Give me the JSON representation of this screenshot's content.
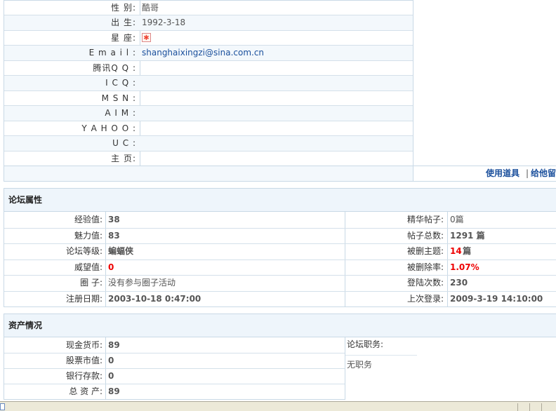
{
  "profile": [
    {
      "label": "性 别:",
      "value": "酷哥"
    },
    {
      "label": "出 生:",
      "value": "1992-3-18"
    },
    {
      "label": "星 座:",
      "value": ""
    },
    {
      "label": "E m a i l :",
      "value": "shanghaixingzi@sina.com.cn"
    },
    {
      "label": "腾讯Q Q :",
      "value": ""
    },
    {
      "label": "I C Q :",
      "value": ""
    },
    {
      "label": "M S N :",
      "value": ""
    },
    {
      "label": "A I M :",
      "value": ""
    },
    {
      "label": "Y A H O O :",
      "value": ""
    },
    {
      "label": "U C :",
      "value": ""
    },
    {
      "label": "主 页:",
      "value": ""
    }
  ],
  "actions": {
    "use_tools": "使用道具",
    "leave_msg": "给他留"
  },
  "forum": {
    "title": "论坛属性",
    "left": [
      {
        "label": "经验值:",
        "value": "38"
      },
      {
        "label": "魅力值:",
        "value": "83"
      },
      {
        "label": "论坛等级:",
        "value": "蝙蝠侠"
      },
      {
        "label": "威望值:",
        "value": "0"
      },
      {
        "label": "圈 子:",
        "value": "没有参与圈子活动"
      },
      {
        "label": "注册日期:",
        "value": "2003-10-18 0:47:00"
      }
    ],
    "right": [
      {
        "label": "精华帖子:",
        "value": "0篇"
      },
      {
        "label": "帖子总数:",
        "value": "1291 篇"
      },
      {
        "label": "被删主题:",
        "value": "14",
        "suffix": " 篇"
      },
      {
        "label": "被删除率:",
        "value": "1.07%"
      },
      {
        "label": "登陆次数:",
        "value": "230"
      },
      {
        "label": "上次登录:",
        "value": "2009-3-19 14:10:00"
      }
    ]
  },
  "assets": {
    "title": "资产情况",
    "rows": [
      {
        "label": "现金货币:",
        "value": "89"
      },
      {
        "label": "股票市值:",
        "value": "0"
      },
      {
        "label": "银行存款:",
        "value": "0"
      },
      {
        "label": "总 资 产:",
        "value": "89"
      }
    ],
    "duty_label": "论坛职务:",
    "duty_value": "无职务"
  },
  "colors": {
    "accent": "#1a4f9c",
    "alert": "#e00000",
    "border": "#c9d9e6"
  }
}
